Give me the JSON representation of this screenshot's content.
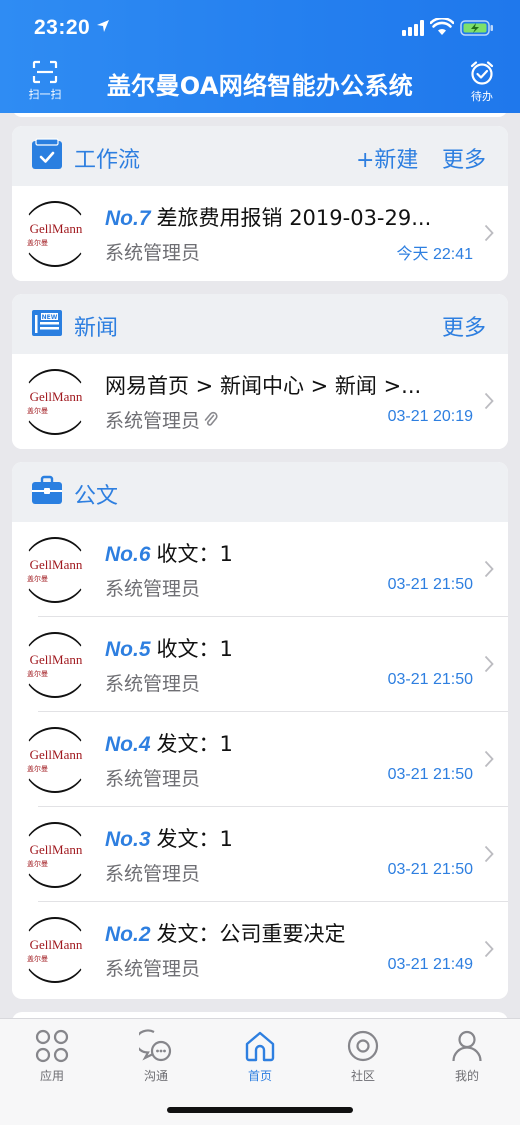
{
  "status": {
    "time": "23:20"
  },
  "nav": {
    "title": "盖尔曼OA网络智能办公系统",
    "scan_label": "扫一扫",
    "todo_label": "待办"
  },
  "colors": {
    "header_blue": "#2580ef",
    "accent": "#2e7fe0",
    "logo_red": "#a0181e"
  },
  "workflow": {
    "title": "工作流",
    "new_label": "+新建",
    "more_label": "更多",
    "items": [
      {
        "no": "No.7",
        "title": "差旅费用报销 2019-03-29...",
        "author": "系统管理员",
        "time": "今天 22:41"
      }
    ]
  },
  "news": {
    "title": "新闻",
    "more_label": "更多",
    "items": [
      {
        "title": "网易首页 > 新闻中心 > 新闻 >...",
        "author": "系统管理员",
        "time": "03-21 20:19",
        "has_attachment": true
      }
    ]
  },
  "documents": {
    "title": "公文",
    "items": [
      {
        "no": "No.6",
        "title": "收文：1",
        "author": "系统管理员",
        "time": "03-21 21:50"
      },
      {
        "no": "No.5",
        "title": "收文：1",
        "author": "系统管理员",
        "time": "03-21 21:50"
      },
      {
        "no": "No.4",
        "title": "发文：1",
        "author": "系统管理员",
        "time": "03-21 21:50"
      },
      {
        "no": "No.3",
        "title": "发文：1",
        "author": "系统管理员",
        "time": "03-21 21:50"
      },
      {
        "no": "No.2",
        "title": "发文：公司重要决定",
        "author": "系统管理员",
        "time": "03-21 21:49"
      }
    ]
  },
  "logo": {
    "en": "GellMann",
    "cn": "盖尔曼"
  },
  "tabs": [
    {
      "label": "应用",
      "icon": "apps-icon",
      "active": false
    },
    {
      "label": "沟通",
      "icon": "chat-icon",
      "active": false
    },
    {
      "label": "首页",
      "icon": "home-icon",
      "active": true
    },
    {
      "label": "社区",
      "icon": "community-icon",
      "active": false
    },
    {
      "label": "我的",
      "icon": "profile-icon",
      "active": false
    }
  ]
}
